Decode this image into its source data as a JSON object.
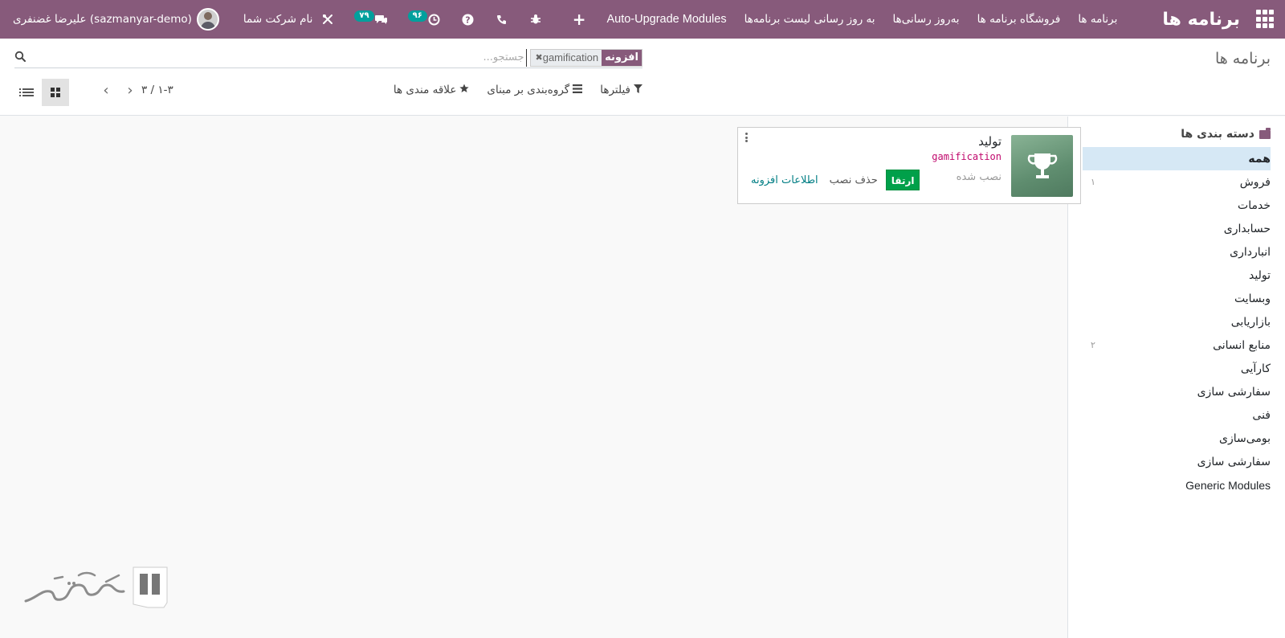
{
  "navbar": {
    "brand": "برنامه ها",
    "menu": [
      {
        "label": "برنامه ها"
      },
      {
        "label": "فروشگاه برنامه ها"
      },
      {
        "label": "به‌روز رسانی‌ها"
      },
      {
        "label": "به روز رسانی لیست برنامه‌ها"
      },
      {
        "label": "Auto-Upgrade Modules"
      }
    ],
    "plus": "+",
    "systray": {
      "user_name": "علیرضا غضنفری (sazmanyar-demo)",
      "company_name": "نام شرکت شما",
      "messages_count": "۷۹",
      "activities_count": "۹۶"
    }
  },
  "control_panel": {
    "breadcrumb": "برنامه ها",
    "search": {
      "facet_label": "افزونه",
      "facet_value": "gamification",
      "placeholder": "جستجو..."
    },
    "filters_label": "فیلترها",
    "groupby_label": "گروه‌بندی بر مبنای",
    "favorites_label": "علاقه مندی ها",
    "pager_value": "۱-۳ / ۳"
  },
  "side_panel": {
    "title": "دسته بندی ها",
    "items": [
      {
        "label": "همه",
        "count": ""
      },
      {
        "label": "فروش",
        "count": "۱"
      },
      {
        "label": "خدمات",
        "count": ""
      },
      {
        "label": "حسابداری",
        "count": ""
      },
      {
        "label": "انبارداری",
        "count": ""
      },
      {
        "label": "تولید",
        "count": ""
      },
      {
        "label": "وبسایت",
        "count": ""
      },
      {
        "label": "بازاریابی",
        "count": ""
      },
      {
        "label": "منابع انسانی",
        "count": "۲"
      },
      {
        "label": "کارآیی",
        "count": ""
      },
      {
        "label": "سفارشی سازی",
        "count": ""
      },
      {
        "label": "فنی",
        "count": ""
      },
      {
        "label": "بومی‌سازی",
        "count": ""
      },
      {
        "label": "سفارشی سازی",
        "count": ""
      },
      {
        "label": "Generic Modules",
        "count": ""
      }
    ]
  },
  "module_card": {
    "title": "تولید",
    "technical_name": "gamification",
    "status": "نصب شده",
    "upgrade_label": "ارتقا",
    "uninstall_label": "حذف نصب",
    "info_label": "اطلاعات افزونه",
    "icon": "trophy-icon"
  },
  "colors": {
    "brand": "#875a7b",
    "badge": "#00a09d",
    "upgrade": "#00a04a",
    "active_category": "#d6e8f5"
  }
}
